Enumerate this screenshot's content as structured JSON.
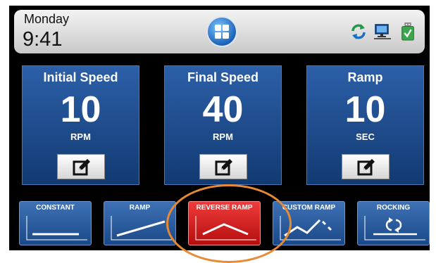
{
  "status": {
    "day": "Monday",
    "time": "9:41"
  },
  "icons": {
    "home": "windows-home-icon",
    "sync": "sync-icon",
    "network": "network-computer-icon",
    "usb": "usb-drive-icon"
  },
  "panels": [
    {
      "title": "Initial Speed",
      "value": "10",
      "unit": "RPM"
    },
    {
      "title": "Final Speed",
      "value": "40",
      "unit": "RPM"
    },
    {
      "title": "Ramp",
      "value": "10",
      "unit": "SEC"
    }
  ],
  "modes": [
    {
      "label": "CONSTANT",
      "selected": false
    },
    {
      "label": "RAMP",
      "selected": false
    },
    {
      "label": "REVERSE RAMP",
      "selected": true
    },
    {
      "label": "CUSTOM RAMP",
      "selected": false
    },
    {
      "label": "ROCKING",
      "selected": false
    }
  ],
  "colors": {
    "panel_blue": "#1d4a8a",
    "active_red": "#d41e1e",
    "highlight_orange": "#e88a33"
  }
}
